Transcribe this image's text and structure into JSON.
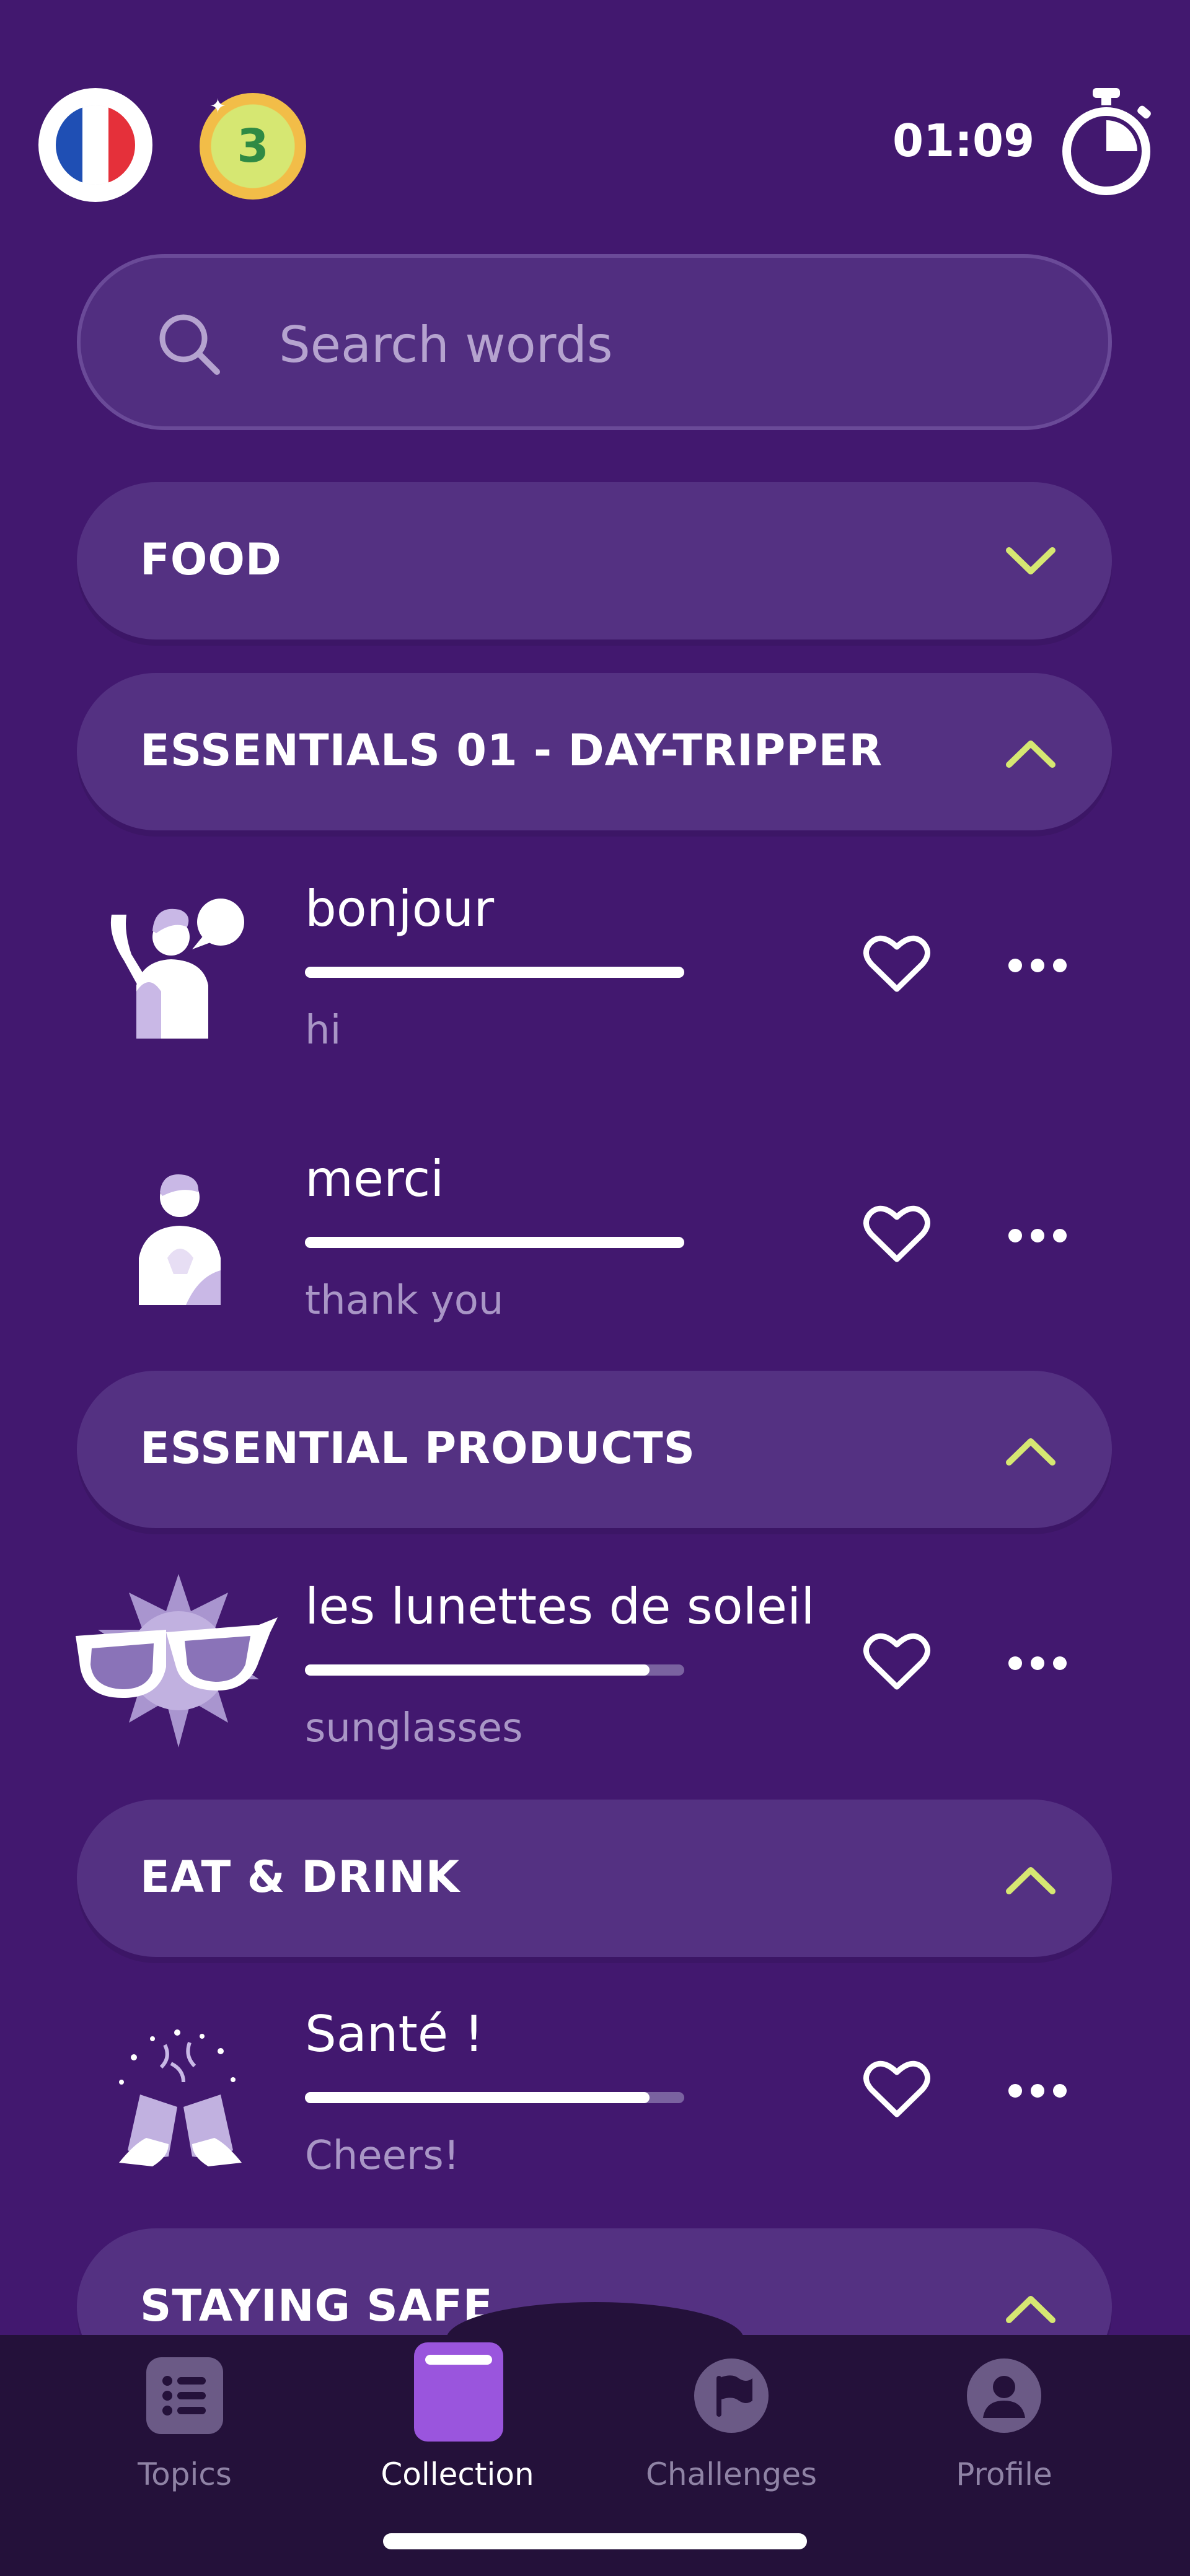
{
  "topbar": {
    "level": "3",
    "timer": "01:09",
    "flag_colors": [
      "#1f4fb4",
      "#ffffff",
      "#e5303a"
    ]
  },
  "search": {
    "placeholder": "Search words"
  },
  "sections": [
    {
      "title": "FOOD",
      "expanded": false
    },
    {
      "title": "ESSENTIALS 01 - DAY-TRIPPER",
      "expanded": true
    },
    {
      "title": "ESSENTIAL PRODUCTS",
      "expanded": true
    },
    {
      "title": "EAT & DRINK",
      "expanded": true
    },
    {
      "title": "STAYING SAFE",
      "expanded": true
    }
  ],
  "words": [
    {
      "word": "bonjour",
      "translation": "hi",
      "progress": 1.0
    },
    {
      "word": "merci",
      "translation": "thank you",
      "progress": 1.0
    },
    {
      "word": "les lunettes de soleil",
      "translation": "sunglasses",
      "progress": 0.9
    },
    {
      "word": "Santé !",
      "translation": "Cheers!",
      "progress": 0.9
    }
  ],
  "nav": {
    "items": [
      {
        "label": "Topics",
        "icon": "list-icon",
        "active": false
      },
      {
        "label": "Collection",
        "icon": "book-icon",
        "active": true
      },
      {
        "label": "Challenges",
        "icon": "flag-icon",
        "active": false
      },
      {
        "label": "Profile",
        "icon": "person-icon",
        "active": false
      }
    ]
  },
  "colors": {
    "background": "#42186f",
    "section": "#543182",
    "accent": "#d6e772",
    "nav": "#24113a",
    "collection": "#9a55dd"
  }
}
